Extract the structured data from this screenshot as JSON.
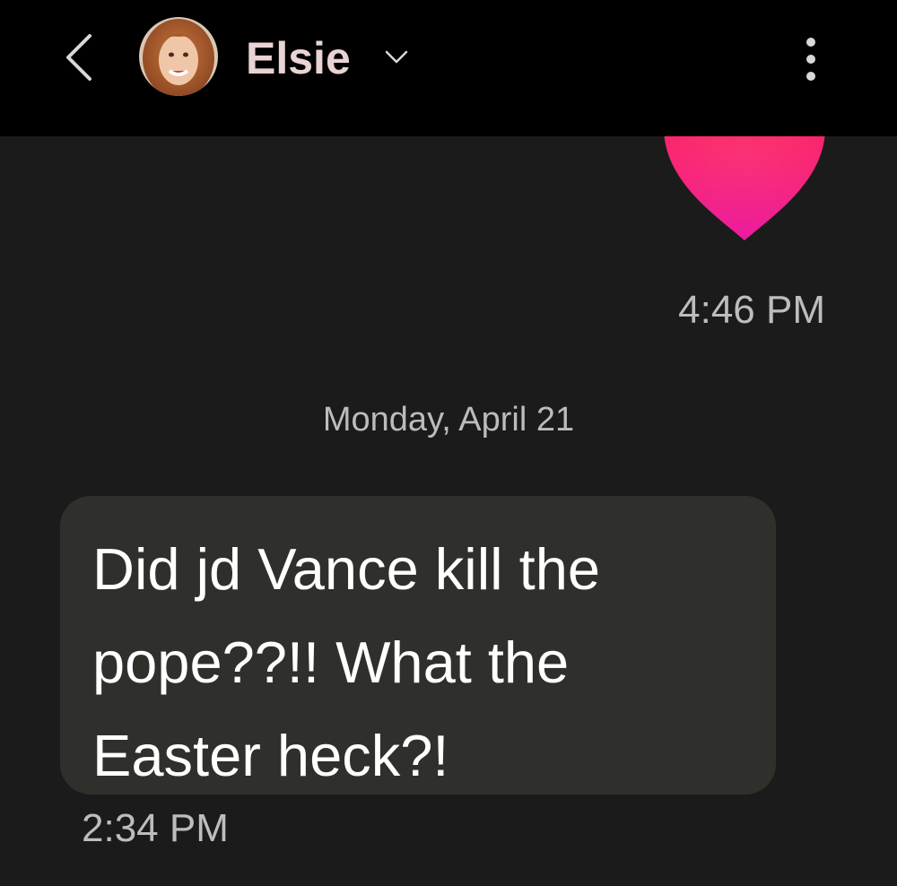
{
  "header": {
    "contact_name": "Elsie",
    "back_icon": "chevron-left-icon",
    "dropdown_icon": "chevron-down-icon",
    "menu_icon": "more-vertical-icon",
    "name_color": "#ead3d3",
    "background": "#000000"
  },
  "conversation": {
    "sent_message": {
      "content": "heart-emoji",
      "time": "4:46 PM"
    },
    "date_divider": "Monday, April 21",
    "received_message": {
      "text": "Did jd Vance kill the pope??!! What the Easter heck?!",
      "time": "2:34 PM",
      "bubble_color": "#2f302c"
    },
    "background": "#1b1b1b"
  }
}
